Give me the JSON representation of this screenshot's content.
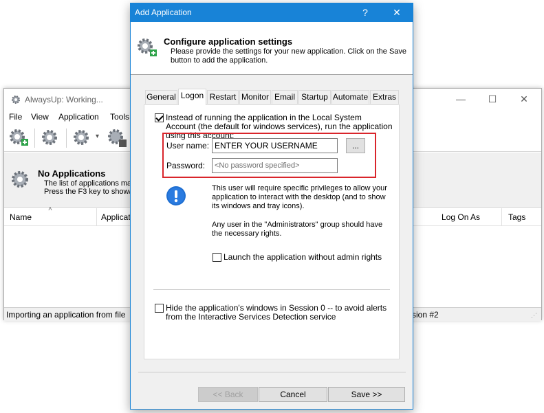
{
  "bg_window": {
    "title": "AlwaysUp: Working...",
    "menu": [
      "File",
      "View",
      "Application",
      "Tools"
    ],
    "banner_title": "No Applications",
    "banner_line1": "The list of applications ma",
    "banner_line2": "Press the F3 key to show/",
    "columns": [
      "Name",
      "Applicat",
      "Log On As",
      "Tags"
    ],
    "status_text": "Importing an application from file",
    "status_right": "ssion #2"
  },
  "dialog": {
    "title": "Add Application",
    "help_label": "?",
    "close_label": "✕",
    "header_title": "Configure application settings",
    "header_desc": "Please provide the settings for your new application. Click on the Save button to add the application.",
    "tabs": [
      "General",
      "Logon",
      "Restart",
      "Monitor",
      "Email",
      "Startup",
      "Automate",
      "Extras"
    ],
    "active_tab": "Logon",
    "run_as_checkbox_label": "Instead of running the application in the Local System Account (the default for windows services), run the application using this account:",
    "run_as_checked": true,
    "username_label": "User name:",
    "username_value": "ENTER YOUR USERNAME",
    "browse_label": "...",
    "password_label": "Password:",
    "password_placeholder": "<No password specified>",
    "info_text1": "This user will require specific privileges to allow your application to interact with the desktop (and to show its windows and tray icons).",
    "info_text2": "Any user in the \"Administrators\" group should have the necessary rights.",
    "launch_no_admin_label": "Launch the application without admin rights",
    "launch_no_admin_checked": false,
    "hide_session0_label": "Hide the application's windows in Session 0 -- to avoid alerts from the Interactive Services Detection service",
    "hide_session0_checked": false,
    "back_label": "<< Back",
    "cancel_label": "Cancel",
    "save_label": "Save >>"
  },
  "colors": {
    "title_bar": "#1883d7",
    "highlight": "#d9252b"
  }
}
